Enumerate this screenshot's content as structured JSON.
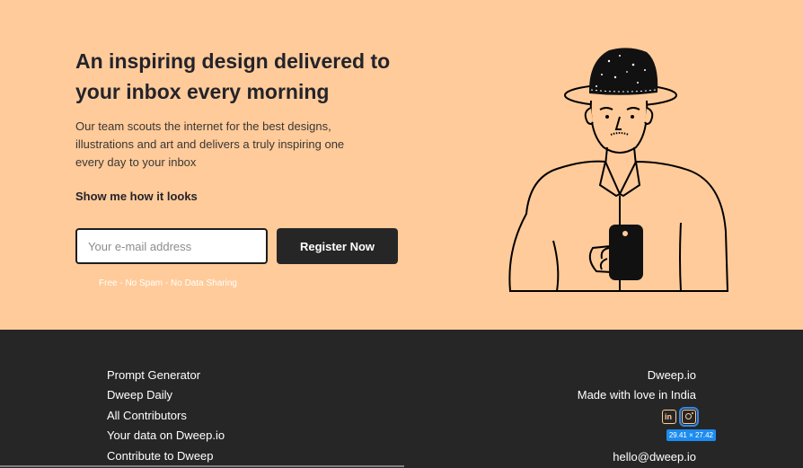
{
  "hero": {
    "headline": "An inspiring design delivered to your inbox every morning",
    "subtext": "Our team scouts the internet for the best designs, illustrations and art and delivers a truly inspiring one every day to your inbox",
    "show_link": "Show me how it looks",
    "email_placeholder": "Your e-mail address",
    "register_label": "Register Now",
    "fine_print": "Free - No Spam - No Data Sharing"
  },
  "illustration": {
    "icon": "man-with-hat-holding-phone-illustration"
  },
  "footer": {
    "links": [
      "Prompt Generator",
      "Dweep Daily",
      "All Contributors",
      "Your data on Dweep.io",
      "Contribute to Dweep"
    ],
    "brand": "Dweep.io",
    "tagline": "Made with love in India",
    "social": [
      "linkedin-icon",
      "instagram-icon"
    ],
    "dimension_badge": "29.41 × 27.42",
    "email": "hello@dweep.io"
  },
  "colors": {
    "hero_bg": "#ffcb9a",
    "footer_bg": "#262626",
    "button_bg": "#262626",
    "badge_bg": "#1d8cf0"
  }
}
